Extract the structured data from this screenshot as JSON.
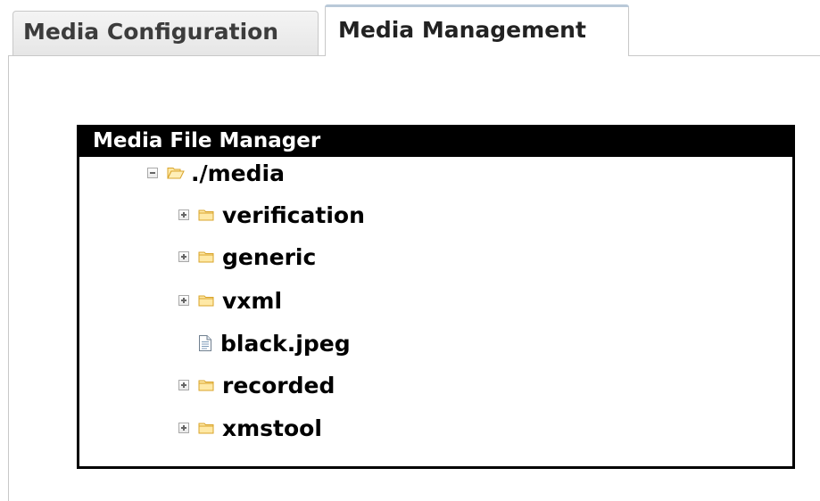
{
  "tabs": [
    {
      "label": "Media Configuration",
      "active": false
    },
    {
      "label": "Media Management",
      "active": true
    }
  ],
  "file_manager": {
    "title": "Media File Manager",
    "root": {
      "label": "./media",
      "expanded": true,
      "icon": "folder-open-icon"
    },
    "items": [
      {
        "label": "verification",
        "type": "folder",
        "expanded": false,
        "icon": "folder-icon"
      },
      {
        "label": "generic",
        "type": "folder",
        "expanded": false,
        "icon": "folder-icon"
      },
      {
        "label": "vxml",
        "type": "folder",
        "expanded": false,
        "icon": "folder-icon"
      },
      {
        "label": "black.jpeg",
        "type": "file",
        "icon": "file-icon"
      },
      {
        "label": "recorded",
        "type": "folder",
        "expanded": false,
        "icon": "folder-icon"
      },
      {
        "label": "xmstool",
        "type": "folder",
        "expanded": false,
        "icon": "folder-icon"
      }
    ]
  },
  "colors": {
    "folder_fill": "#ffe9a6",
    "folder_stroke": "#d9a42a",
    "titlebar_bg": "#000000",
    "titlebar_text": "#ffffff"
  }
}
